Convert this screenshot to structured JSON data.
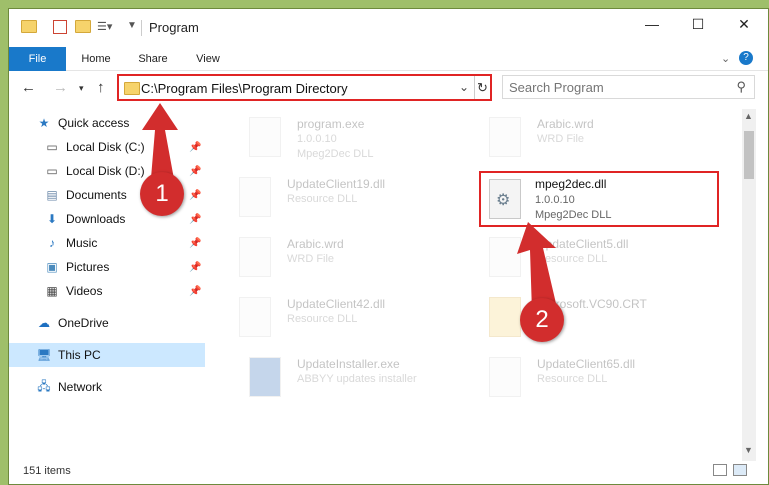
{
  "window": {
    "title": "Program"
  },
  "ribbon": {
    "tabs": [
      "File",
      "Home",
      "Share",
      "View"
    ]
  },
  "address": {
    "path": "C:\\Program Files\\Program Directory"
  },
  "search": {
    "placeholder": "Search Program"
  },
  "sidebar": {
    "items": [
      {
        "label": "Quick access",
        "icon": "star-icon",
        "pinned": false
      },
      {
        "label": "Local Disk (C:)",
        "icon": "drive-icon",
        "pinned": true
      },
      {
        "label": "Local Disk (D:)",
        "icon": "drive-icon",
        "pinned": true
      },
      {
        "label": "Documents",
        "icon": "documents-icon",
        "pinned": true
      },
      {
        "label": "Downloads",
        "icon": "download-icon",
        "pinned": true
      },
      {
        "label": "Music",
        "icon": "music-icon",
        "pinned": true
      },
      {
        "label": "Pictures",
        "icon": "pictures-icon",
        "pinned": true
      },
      {
        "label": "Videos",
        "icon": "videos-icon",
        "pinned": true
      },
      {
        "label": "OneDrive",
        "icon": "cloud-icon",
        "pinned": false
      },
      {
        "label": "This PC",
        "icon": "computer-icon",
        "pinned": false,
        "selected": true
      },
      {
        "label": "Network",
        "icon": "network-icon",
        "pinned": false
      }
    ]
  },
  "files": [
    {
      "name": "program.exe",
      "line1": "1.0.0.10",
      "line2": "Mpeg2Dec DLL",
      "highlighted": false
    },
    {
      "name": "Arabic.wrd",
      "line1": "WRD File",
      "line2": "",
      "highlighted": false
    },
    {
      "name": "UpdateClient19.dll",
      "line1": "Resource DLL",
      "line2": "",
      "highlighted": false
    },
    {
      "name": "mpeg2dec.dll",
      "line1": "1.0.0.10",
      "line2": "Mpeg2Dec DLL",
      "highlighted": true
    },
    {
      "name": "Arabic.wrd",
      "line1": "WRD File",
      "line2": "",
      "highlighted": false
    },
    {
      "name": "UpdateClient5.dll",
      "line1": "Resource DLL",
      "line2": "",
      "highlighted": false
    },
    {
      "name": "UpdateClient42.dll",
      "line1": "Resource DLL",
      "line2": "",
      "highlighted": false
    },
    {
      "name": "Microsoft.VC90.CRT",
      "line1": "",
      "line2": "",
      "highlighted": false
    },
    {
      "name": "UpdateInstaller.exe",
      "line1": "ABBYY updates installer",
      "line2": "",
      "highlighted": false
    },
    {
      "name": "UpdateClient65.dll",
      "line1": "Resource DLL",
      "line2": "",
      "highlighted": false
    }
  ],
  "status": {
    "count": "151 items"
  },
  "annotations": {
    "step1": "1",
    "step2": "2",
    "color": "#d22d2d"
  }
}
